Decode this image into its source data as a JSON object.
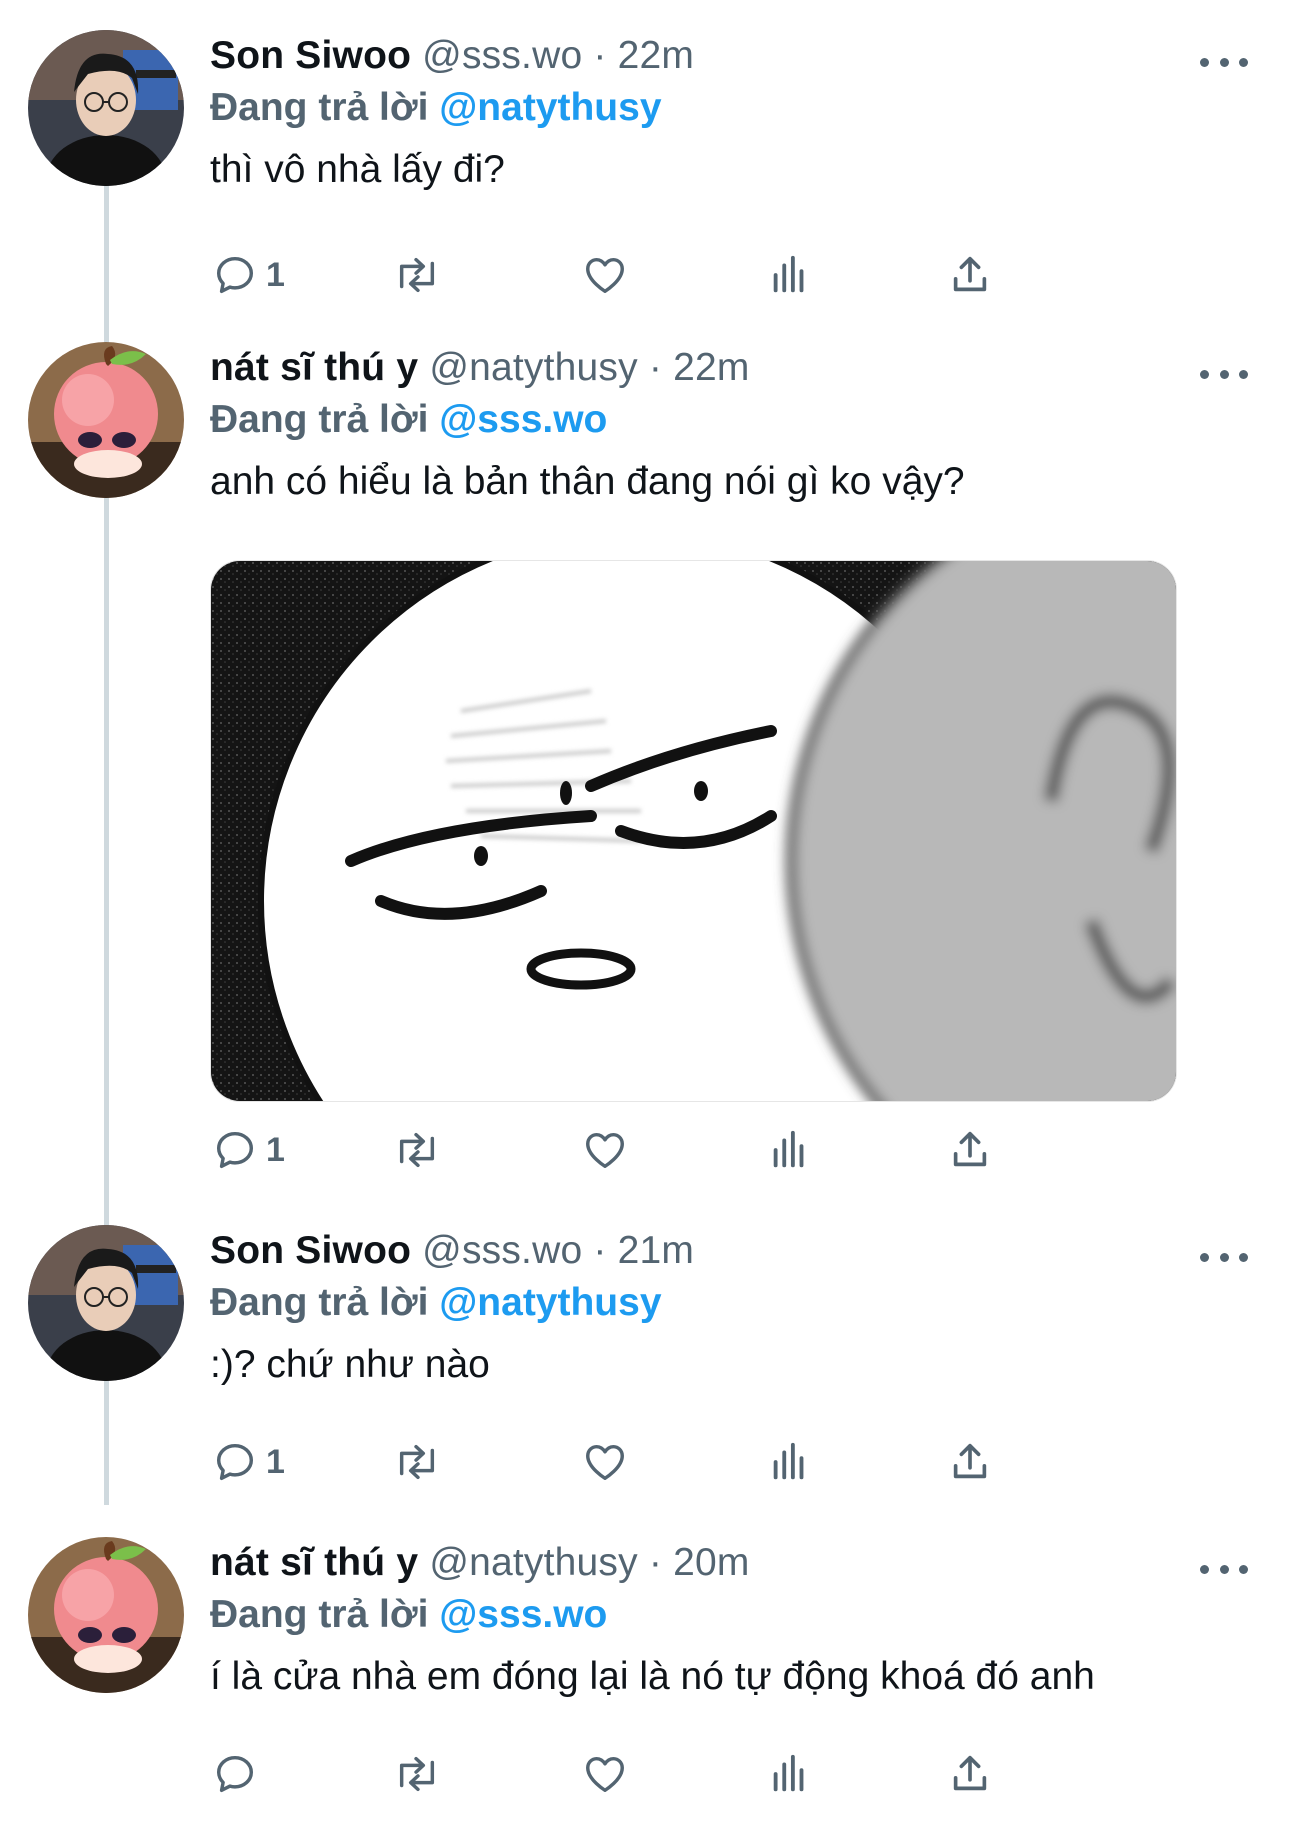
{
  "tweets": [
    {
      "author": "Son Siwoo",
      "handle": "@sss.wo",
      "separator": "·",
      "time": "22m",
      "reply_prefix": "Đang trả lời",
      "reply_to": "@natythusy",
      "text": "thì vô nhà lấy đi?",
      "reply_count": "1",
      "avatar_icon": "avatar-glasses-man"
    },
    {
      "author": "nát sĩ thú y",
      "handle": "@natythusy",
      "separator": "·",
      "time": "22m",
      "reply_prefix": "Đang trả lời",
      "reply_to": "@sss.wo",
      "text": "anh có hiểu là bản thân đang nói gì ko vậy?",
      "reply_count": "1",
      "avatar_icon": "avatar-peach-figure",
      "media": "meme-image"
    },
    {
      "author": "Son Siwoo",
      "handle": "@sss.wo",
      "separator": "·",
      "time": "21m",
      "reply_prefix": "Đang trả lời",
      "reply_to": "@natythusy",
      "text": ":)? chứ như nào",
      "reply_count": "1",
      "avatar_icon": "avatar-glasses-man"
    },
    {
      "author": "nát sĩ thú y",
      "handle": "@natythusy",
      "separator": "·",
      "time": "20m",
      "reply_prefix": "Đang trả lời",
      "reply_to": "@sss.wo",
      "text": "í là cửa nhà em đóng lại là nó tự động khoá đó anh",
      "reply_count": "",
      "avatar_icon": "avatar-peach-figure"
    }
  ],
  "icons": [
    "reply-icon",
    "retweet-icon",
    "like-icon",
    "views-icon",
    "share-icon",
    "more-icon"
  ],
  "colors": {
    "accent": "#1d9bf0",
    "muted": "#536471",
    "text": "#0f1419",
    "thread": "#cfd9de"
  }
}
